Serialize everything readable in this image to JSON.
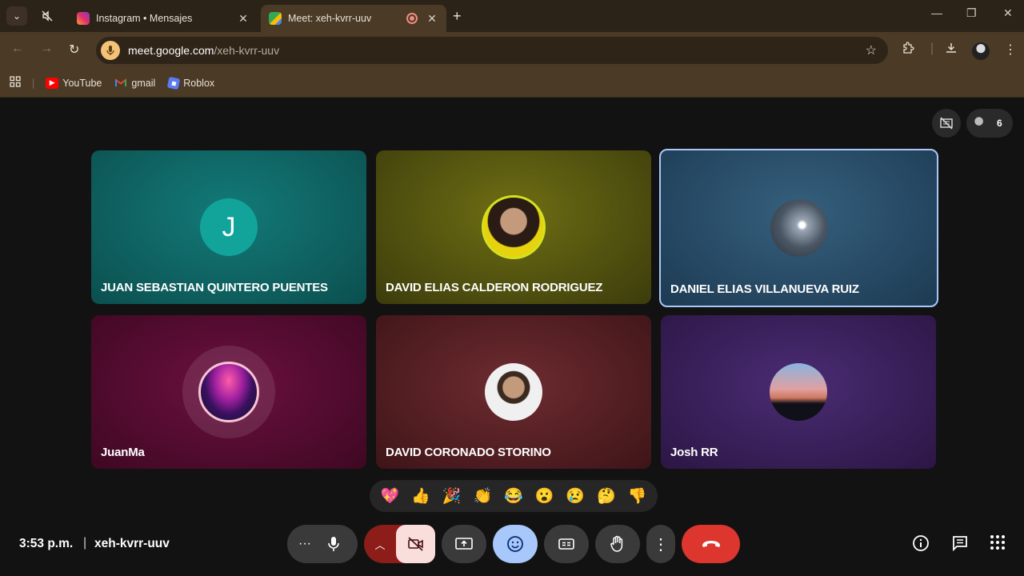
{
  "browser": {
    "tabs": [
      {
        "title": "Instagram • Mensajes",
        "active": false
      },
      {
        "title": "Meet: xeh-kvrr-uuv",
        "active": true
      }
    ],
    "url_host": "meet.google.com",
    "url_path": "/xeh-kvrr-uuv",
    "bookmarks": [
      {
        "label": "YouTube",
        "icon": "youtube-icon"
      },
      {
        "label": "gmail",
        "icon": "gmail-icon"
      },
      {
        "label": "Roblox",
        "icon": "roblox-icon"
      }
    ]
  },
  "meet": {
    "participant_count": "6",
    "participants": [
      {
        "name": "JUAN SEBASTIAN QUINTERO PUENTES",
        "avatar_letter": "J",
        "color": "#0f5e5d"
      },
      {
        "name": "DAVID ELIAS CALDERON RODRIGUEZ",
        "color": "#5a5a10"
      },
      {
        "name": "DANIEL ELIAS VILLANUEVA RUIZ",
        "color": "#284a66"
      },
      {
        "name": "JuanMa",
        "color": "#5a0a32"
      },
      {
        "name": "DAVID CORONADO STORINO",
        "color": "#5e2428"
      },
      {
        "name": "Josh RR",
        "color": "#3e2462"
      }
    ],
    "reactions": [
      "💖",
      "👍",
      "🎉",
      "👏",
      "😂",
      "😮",
      "😢",
      "🤔",
      "👎"
    ],
    "time": "3:53 p.m.",
    "meeting_code": "xeh-kvrr-uuv"
  },
  "colors": {
    "accent_blue": "#a8c7fa",
    "end_call_red": "#dc362e",
    "chrome_bg": "#4a3a26"
  }
}
